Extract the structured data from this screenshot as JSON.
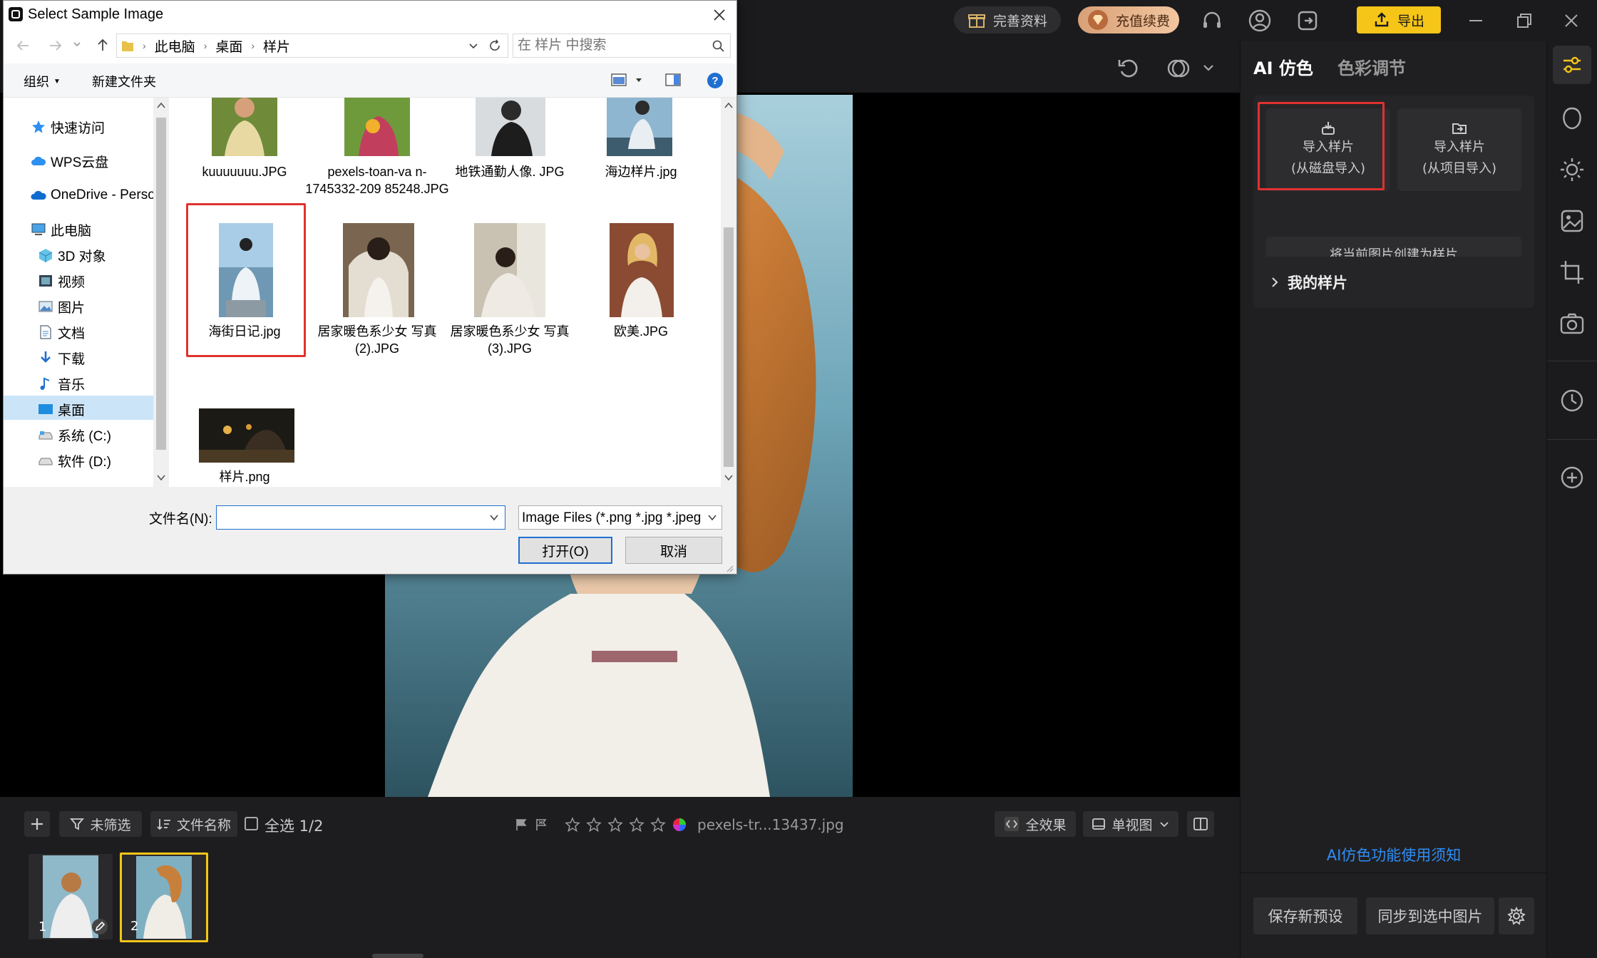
{
  "topbar": {
    "profile_label": "完善资料",
    "renew_label": "充值续费",
    "export_label": "导出"
  },
  "right_panel": {
    "tabs": [
      "AI 仿色",
      "色彩调节"
    ],
    "import_disk_line1": "导入样片",
    "import_disk_line2": "(从磁盘导入)",
    "import_project_line1": "导入样片",
    "import_project_line2": "(从项目导入)",
    "create_sample_label": "将当前图片创建为样片",
    "my_samples_label": "我的样片",
    "notice_link": "AI仿色功能使用须知",
    "save_preset_label": "保存新预设",
    "sync_label": "同步到选中图片"
  },
  "bottom_bar": {
    "filter_label": "未筛选",
    "sort_label": "文件名称",
    "select_all_label": "全选 1/2",
    "filename": "pexels-tr...13437.jpg",
    "effect_label": "全效果",
    "view_label": "单视图"
  },
  "filmstrip": {
    "items": [
      {
        "index": "1"
      },
      {
        "index": "2"
      }
    ]
  },
  "dialog": {
    "title": "Select Sample Image",
    "breadcrumb": [
      "此电脑",
      "桌面",
      "样片"
    ],
    "search_placeholder": "在 样片 中搜索",
    "organize_label": "组织",
    "new_folder_label": "新建文件夹",
    "nav_items": [
      {
        "label": "快速访问",
        "icon": "star-icon"
      },
      {
        "label": "WPS云盘",
        "icon": "cloud-icon"
      },
      {
        "label": "OneDrive - Perso",
        "icon": "onedrive-icon"
      },
      {
        "label": "此电脑",
        "icon": "computer-icon"
      },
      {
        "label": "3D 对象",
        "icon": "cube-icon"
      },
      {
        "label": "视频",
        "icon": "video-icon"
      },
      {
        "label": "图片",
        "icon": "picture-icon"
      },
      {
        "label": "文档",
        "icon": "document-icon"
      },
      {
        "label": "下载",
        "icon": "download-icon"
      },
      {
        "label": "音乐",
        "icon": "music-icon"
      },
      {
        "label": "桌面",
        "icon": "desktop-icon"
      },
      {
        "label": "系统 (C:)",
        "icon": "drive-icon"
      },
      {
        "label": "软件 (D:)",
        "icon": "drive-icon"
      }
    ],
    "files": [
      {
        "name": "kuuuuuuu.JPG"
      },
      {
        "name": "pexels-toan-va n-1745332-209 85248.JPG"
      },
      {
        "name": "地铁通勤人像. JPG"
      },
      {
        "name": "海边样片.jpg"
      },
      {
        "name": "海街日记.jpg"
      },
      {
        "name": "居家暖色系少女 写真 (2).JPG"
      },
      {
        "name": "居家暖色系少女 写真 (3).JPG"
      },
      {
        "name": "欧美.JPG"
      },
      {
        "name": "样片.png"
      }
    ],
    "filename_label": "文件名(N):",
    "filename_value": "",
    "filetype_label": "Image Files (*.png *.jpg *.jpeg",
    "open_label": "打开(O)",
    "cancel_label": "取消"
  },
  "colors": {
    "accent_yellow": "#f5c518",
    "highlight_red": "#e0322f",
    "link_blue": "#2f8df5"
  }
}
